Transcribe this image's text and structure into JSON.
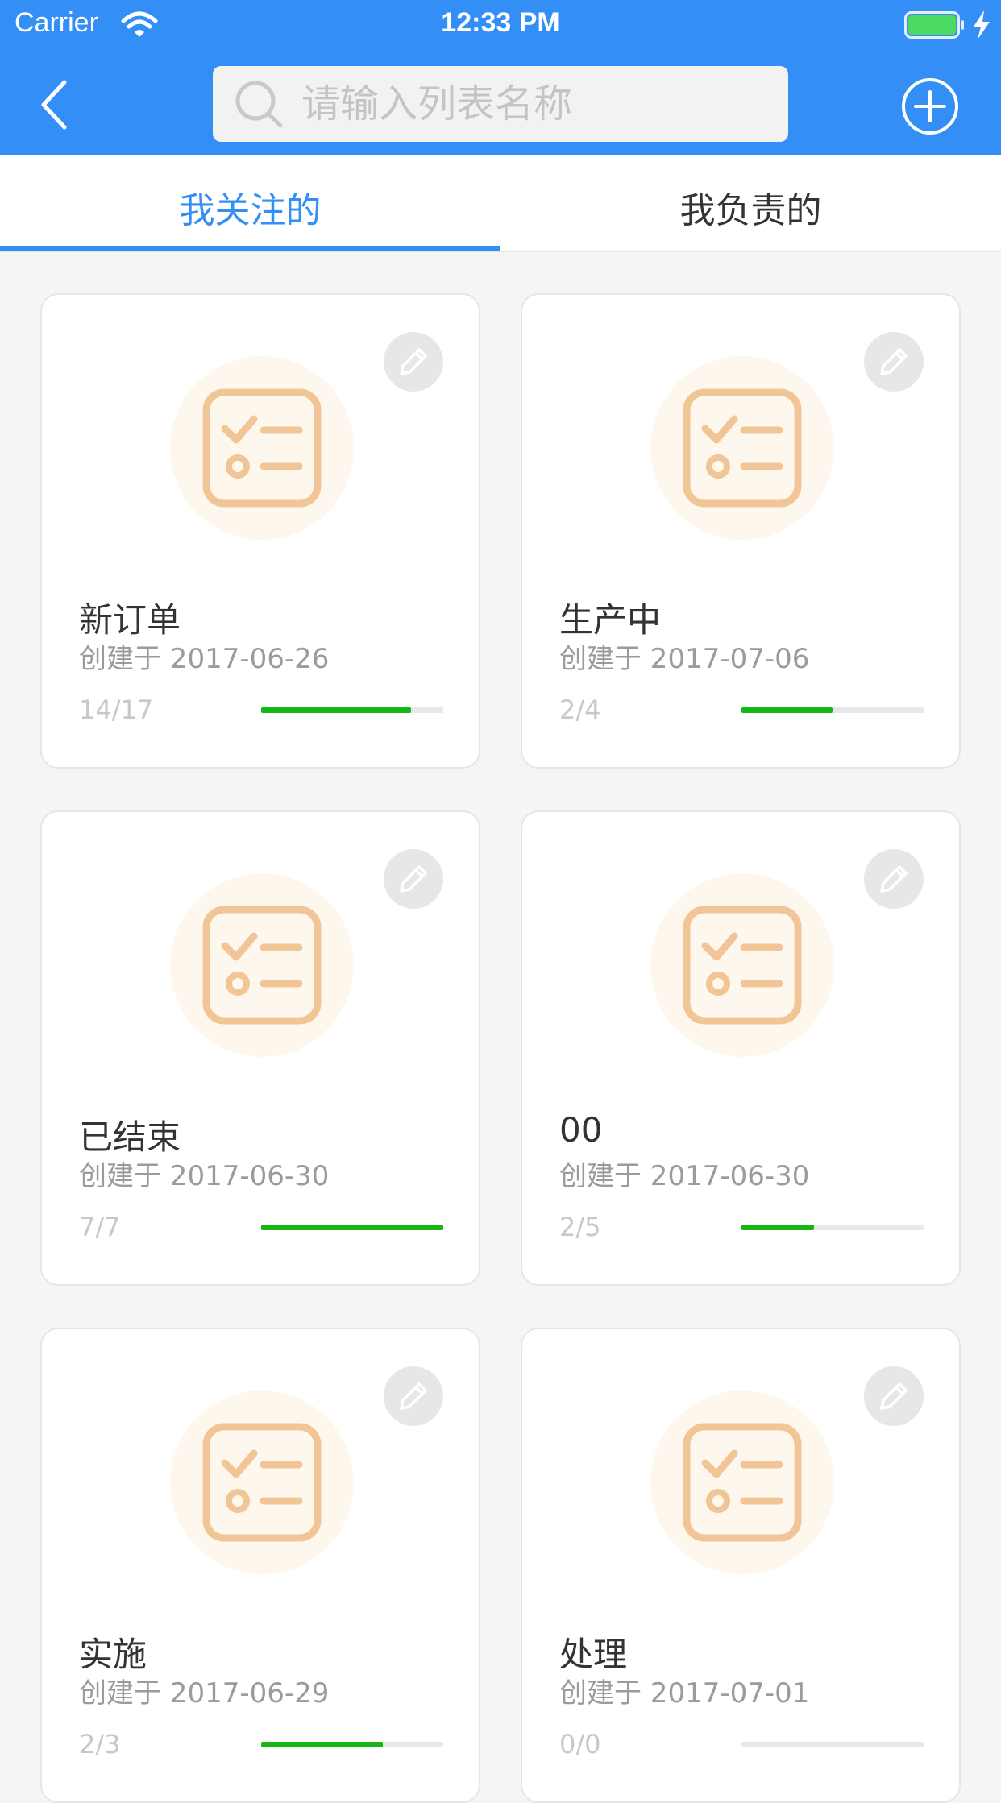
{
  "status_bar": {
    "carrier": "Carrier",
    "time": "12:33 PM"
  },
  "header": {
    "back_icon": "chevron-left-icon",
    "search_icon": "search-icon",
    "search_placeholder": "请输入列表名称",
    "search_value": "",
    "add_icon": "plus-circle-icon"
  },
  "tabs": [
    {
      "label": "我关注的",
      "active": true
    },
    {
      "label": "我负责的",
      "active": false
    }
  ],
  "cards": [
    {
      "title": "新订单",
      "created": "创建于 2017-06-26",
      "count": "14/17",
      "progress": 0.8235
    },
    {
      "title": "生产中",
      "created": "创建于 2017-07-06",
      "count": "2/4",
      "progress": 0.5
    },
    {
      "title": "已结束",
      "created": "创建于 2017-06-30",
      "count": "7/7",
      "progress": 1.0
    },
    {
      "title": "00",
      "created": "创建于 2017-06-30",
      "count": "2/5",
      "progress": 0.4
    },
    {
      "title": "实施",
      "created": "创建于 2017-06-29",
      "count": "2/3",
      "progress": 0.6667
    },
    {
      "title": "处理",
      "created": "创建于 2017-07-01",
      "count": "0/0",
      "progress": 0
    }
  ],
  "colors": {
    "primary": "#338ef5",
    "progress": "#17b713",
    "icon": "#f2c597",
    "icon_bg": "#fef7ee"
  }
}
